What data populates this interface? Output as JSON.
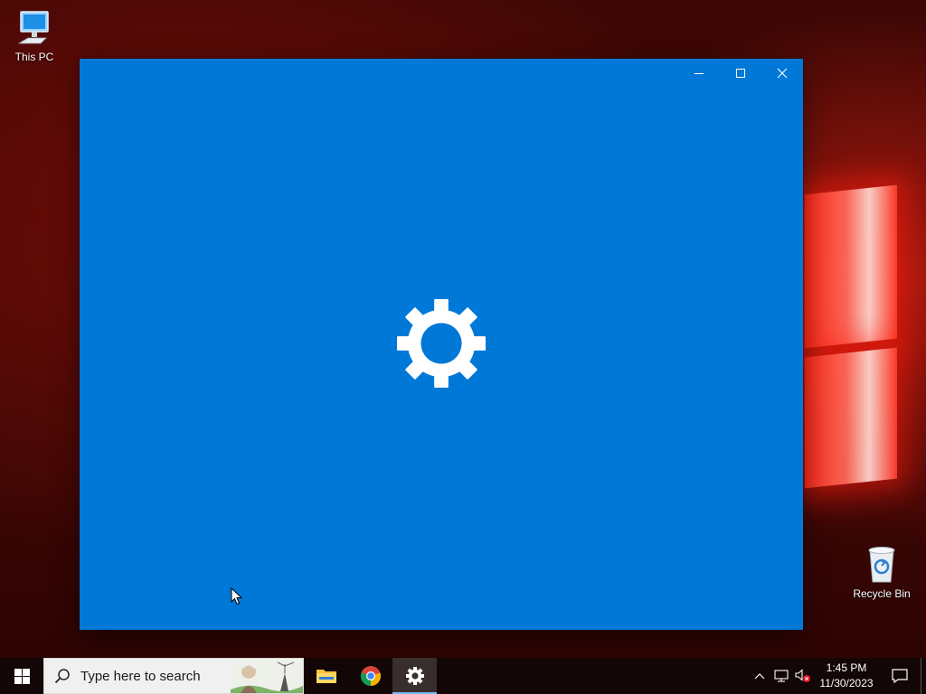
{
  "desktop": {
    "icons": [
      {
        "label": "This PC"
      },
      {
        "label": "Recycle Bin"
      }
    ]
  },
  "window": {
    "app": "Settings",
    "background": "#0078d7",
    "splash_icon": "gear-icon",
    "caption": {
      "minimize": "minimize-icon",
      "maximize": "maximize-icon",
      "close": "close-icon"
    }
  },
  "taskbar": {
    "start_icon": "windows-logo-icon",
    "search": {
      "placeholder": "Type here to search"
    },
    "apps": [
      {
        "name": "File Explorer",
        "icon": "folder-icon",
        "active": false
      },
      {
        "name": "Google Chrome",
        "icon": "chrome-icon",
        "active": false
      },
      {
        "name": "Settings",
        "icon": "gear-icon",
        "active": true
      }
    ],
    "tray": {
      "time": "1:45 PM",
      "date": "11/30/2023",
      "icons": [
        "chevron-up-icon",
        "network-icon",
        "volume-muted-icon",
        "notification-icon"
      ]
    }
  },
  "colors": {
    "accent": "#0078d7",
    "taskbar_active_indicator": "#76b9ed"
  }
}
